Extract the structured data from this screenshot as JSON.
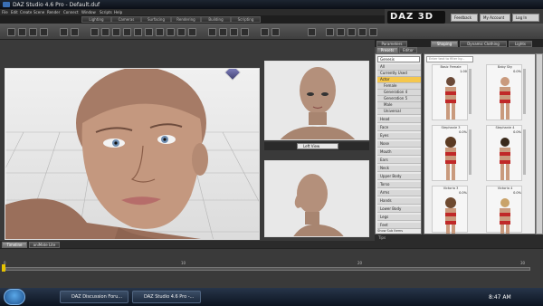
{
  "window": {
    "title": "DAZ Studio 4.6 Pro - Default.duf"
  },
  "menu": [
    "File",
    "Edit",
    "Create",
    "Scene",
    "Render",
    "Connect",
    "Window",
    "Scripts",
    "Help"
  ],
  "logo": "DAZ 3D",
  "top_buttons": [
    "Feedback",
    "My Account",
    "Log In"
  ],
  "rooms": [
    "Lighting",
    "Cameras",
    "Surfacing",
    "Rendering",
    "Building",
    "Scripting"
  ],
  "viewports": {
    "bottom_right_view": "Left View"
  },
  "panel_tabs": [
    "Parameters",
    "Shaping",
    "Dynamic Clothing",
    "Lights"
  ],
  "panel_subtabs": [
    "Presets",
    "Editor"
  ],
  "shaping": {
    "dropdown": "Genesis",
    "search_placeholder": "Enter text to filter by...",
    "list": [
      {
        "label": "All",
        "selected": false
      },
      {
        "label": "Currently Used",
        "selected": false
      },
      {
        "label": "Actor",
        "selected": true
      },
      {
        "label": "Female",
        "selected": false
      },
      {
        "label": "Generation 4",
        "selected": false
      },
      {
        "label": "Generation 5",
        "selected": false
      },
      {
        "label": "Male",
        "selected": false
      },
      {
        "label": "Universal",
        "selected": false
      },
      {
        "label": "Head",
        "selected": false
      },
      {
        "label": "Face",
        "selected": false
      },
      {
        "label": "Eyes",
        "selected": false
      },
      {
        "label": "Nose",
        "selected": false
      },
      {
        "label": "Mouth",
        "selected": false
      },
      {
        "label": "Ears",
        "selected": false
      },
      {
        "label": "Neck",
        "selected": false
      },
      {
        "label": "Upper Body",
        "selected": false
      },
      {
        "label": "Torso",
        "selected": false
      },
      {
        "label": "Arms",
        "selected": false
      },
      {
        "label": "Hands",
        "selected": false
      },
      {
        "label": "Lower Body",
        "selected": false
      },
      {
        "label": "Legs",
        "selected": false
      },
      {
        "label": "Feet",
        "selected": false
      }
    ],
    "show_sub_items": "Show Sub Items",
    "thumbnails": [
      {
        "label": "Basic Female",
        "value": "1.00"
      },
      {
        "label": "Baby Sky",
        "value": "0.0%"
      },
      {
        "label": "Stephanie 3",
        "value": "0.0%"
      },
      {
        "label": "Stephanie 4",
        "value": "0.0%"
      },
      {
        "label": "Victoria 3",
        "value": "0.0%"
      },
      {
        "label": "Victoria 4",
        "value": "0.0%"
      }
    ]
  },
  "tips": "Tips",
  "bottom_tabs": [
    "Timeline",
    "aniMate Lite"
  ],
  "timeline_ticks": [
    "0",
    "10",
    "20",
    "30"
  ],
  "taskbar": {
    "tasks": [
      "DAZ Discussion Foru...",
      "DAZ Studio 4.6 Pro -..."
    ],
    "clock": "8:47 AM"
  },
  "colors": {
    "selected_item": "#f5c74d",
    "title_bar": "#0b0f16"
  }
}
